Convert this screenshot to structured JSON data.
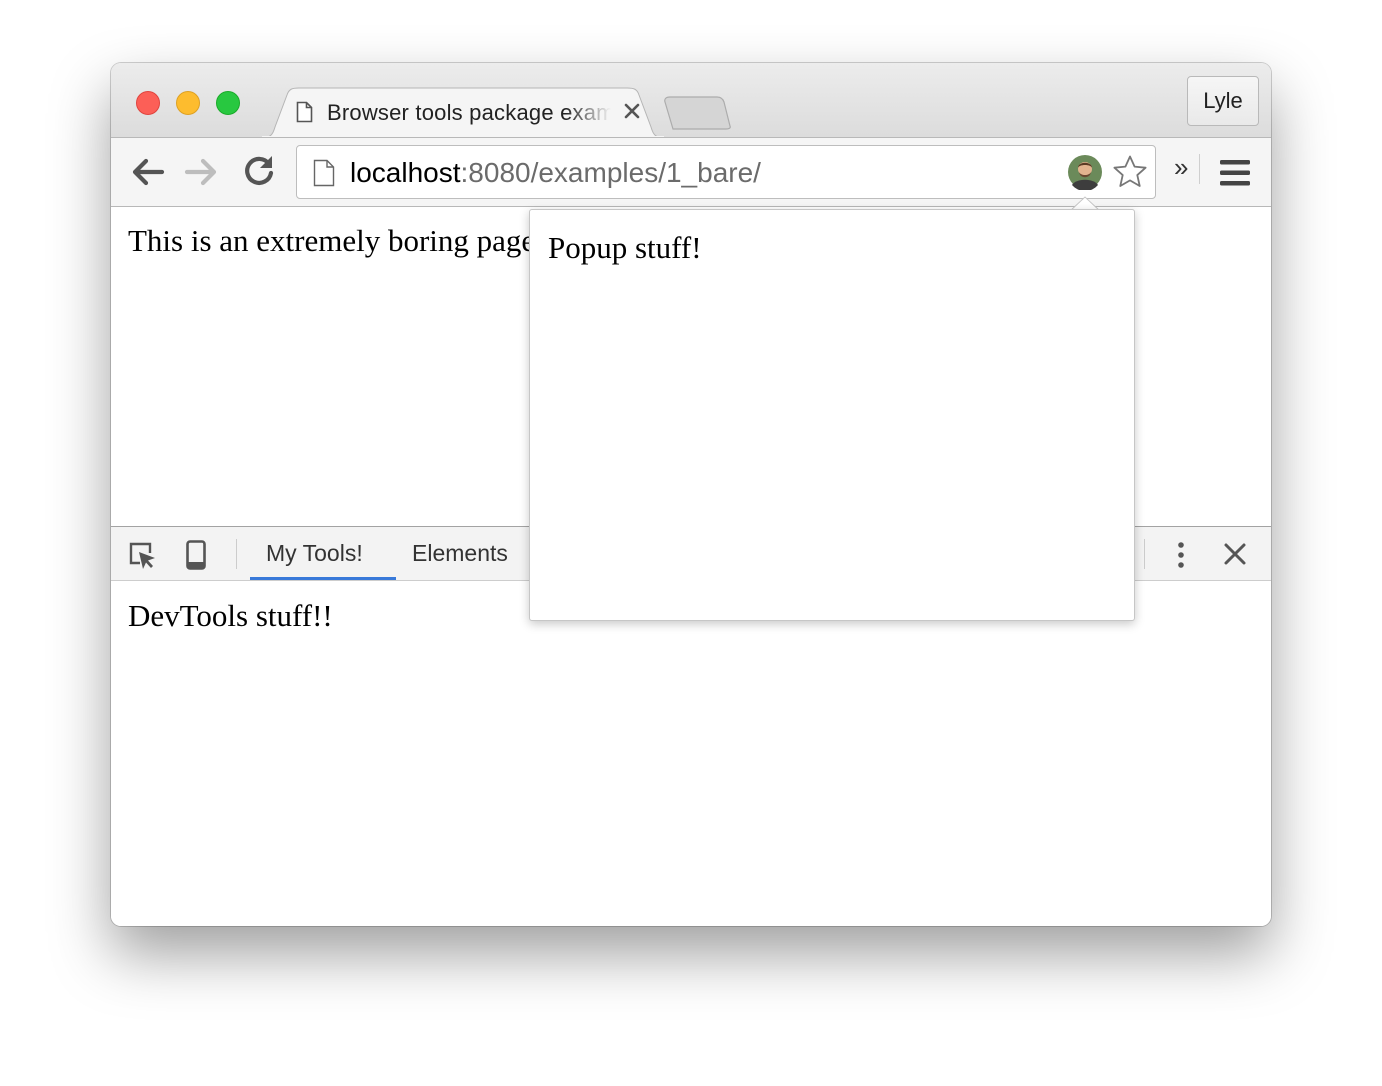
{
  "window": {
    "tab": {
      "title": "Browser tools package example"
    },
    "profile": {
      "name": "Lyle"
    }
  },
  "toolbar": {
    "url_host": "localhost",
    "url_path": ":8080/examples/1_bare/",
    "overflow_label": "»"
  },
  "page": {
    "body_text": "This is an extremely boring page."
  },
  "popup": {
    "text": "Popup stuff!"
  },
  "devtools": {
    "tabs": [
      "My Tools!",
      "Elements"
    ],
    "active_tab": "My Tools!",
    "body_text": "DevTools stuff!!"
  },
  "colors": {
    "traffic_red": "#fc5f57",
    "traffic_yellow": "#fdbc2e",
    "traffic_green": "#28c840",
    "devtools_active_tab": "#3879d9"
  },
  "icons": [
    "document-icon",
    "tab-close-icon",
    "back-arrow-icon",
    "forward-arrow-icon",
    "reload-icon",
    "extension-avatar-icon",
    "bookmark-star-icon",
    "chrome-menu-icon",
    "inspect-element-icon",
    "device-mode-icon",
    "kebab-menu-icon",
    "devtools-close-icon"
  ]
}
